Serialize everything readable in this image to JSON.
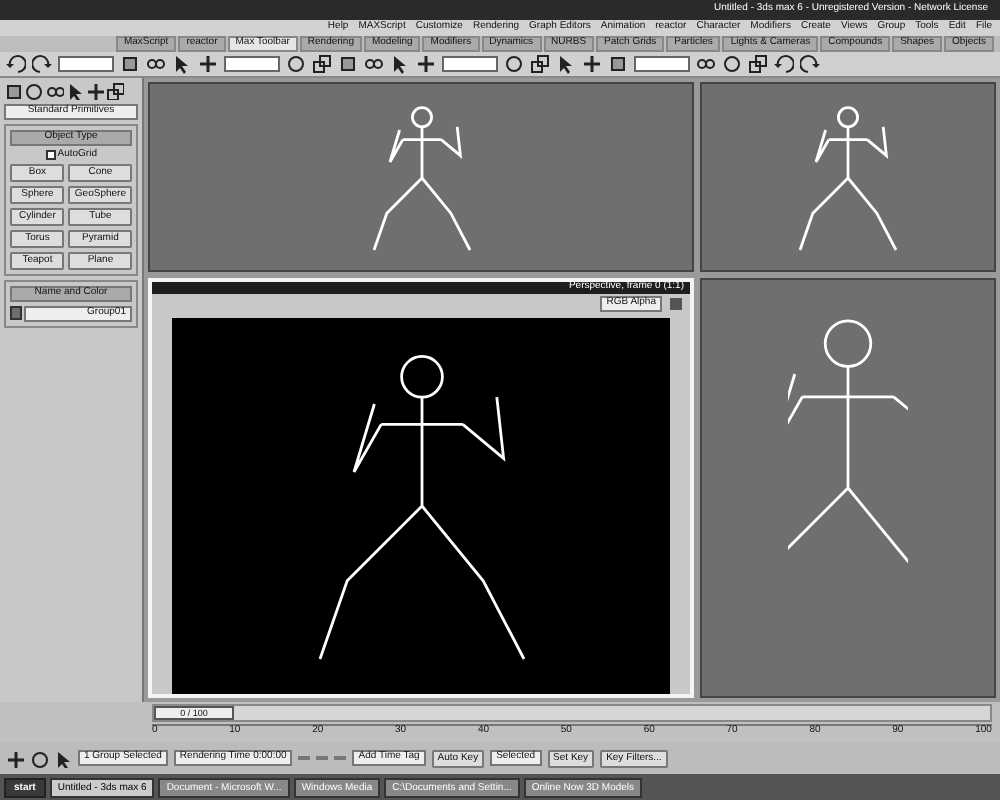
{
  "window": {
    "title": "Untitled - 3ds max 6 - Unregistered Version - Network License"
  },
  "menu": [
    "Help",
    "MAXScript",
    "Customize",
    "Rendering",
    "Graph Editors",
    "Animation",
    "reactor",
    "Character",
    "Modifiers",
    "Create",
    "Views",
    "Group",
    "Tools",
    "Edit",
    "File"
  ],
  "tab_panel": [
    {
      "label": "MaxScript",
      "selected": false
    },
    {
      "label": "reactor",
      "selected": false
    },
    {
      "label": "Max Toolbar",
      "selected": true
    },
    {
      "label": "Rendering",
      "selected": false
    },
    {
      "label": "Modeling",
      "selected": false
    },
    {
      "label": "Modifiers",
      "selected": false
    },
    {
      "label": "Dynamics",
      "selected": false
    },
    {
      "label": "NURBS",
      "selected": false
    },
    {
      "label": "Patch Grids",
      "selected": false
    },
    {
      "label": "Particles",
      "selected": false
    },
    {
      "label": "Lights & Cameras",
      "selected": false
    },
    {
      "label": "Compounds",
      "selected": false
    },
    {
      "label": "Shapes",
      "selected": false
    },
    {
      "label": "Objects",
      "selected": false
    }
  ],
  "command_panel": {
    "category": "Standard Primitives",
    "object_type": {
      "title": "Object Type",
      "autogrid": {
        "label": "AutoGrid",
        "checked": false
      },
      "buttons": [
        "Box",
        "Cone",
        "Sphere",
        "GeoSphere",
        "Cylinder",
        "Tube",
        "Torus",
        "Pyramid",
        "Teapot",
        "Plane"
      ]
    },
    "name_and_color": {
      "title": "Name and Color",
      "name": "Group01",
      "color": "#6e6e6e"
    }
  },
  "viewports": [
    {
      "kind": "small",
      "active": false
    },
    {
      "kind": "small",
      "active": false
    },
    {
      "kind": "render",
      "active": true,
      "title": "Perspective, frame 0 (1:1)",
      "channel": "RGB Alpha"
    },
    {
      "kind": "small",
      "active": false
    }
  ],
  "timeline": {
    "slider": "0 / 100",
    "level": 0.0,
    "ticks": [
      "0",
      "10",
      "20",
      "30",
      "40",
      "50",
      "60",
      "70",
      "80",
      "90",
      "100"
    ]
  },
  "status": {
    "selection": "1 Group Selected",
    "render_time": "Rendering Time 0:00:00",
    "auto_key": "Auto Key",
    "set_key": "Set Key",
    "key_mode": "Selected",
    "key_filters": "Key Filters...",
    "time_tag": "Add Time Tag"
  },
  "taskbar": {
    "start": "start",
    "tasks": [
      {
        "label": "Untitled - 3ds max 6",
        "selected": true
      },
      {
        "label": "Document - Microsoft W...",
        "selected": false
      },
      {
        "label": "Windows Media",
        "selected": false
      },
      {
        "label": "C:\\Documents and Settin...",
        "selected": false
      },
      {
        "label": "Online Now 3D Models",
        "selected": false
      }
    ]
  }
}
